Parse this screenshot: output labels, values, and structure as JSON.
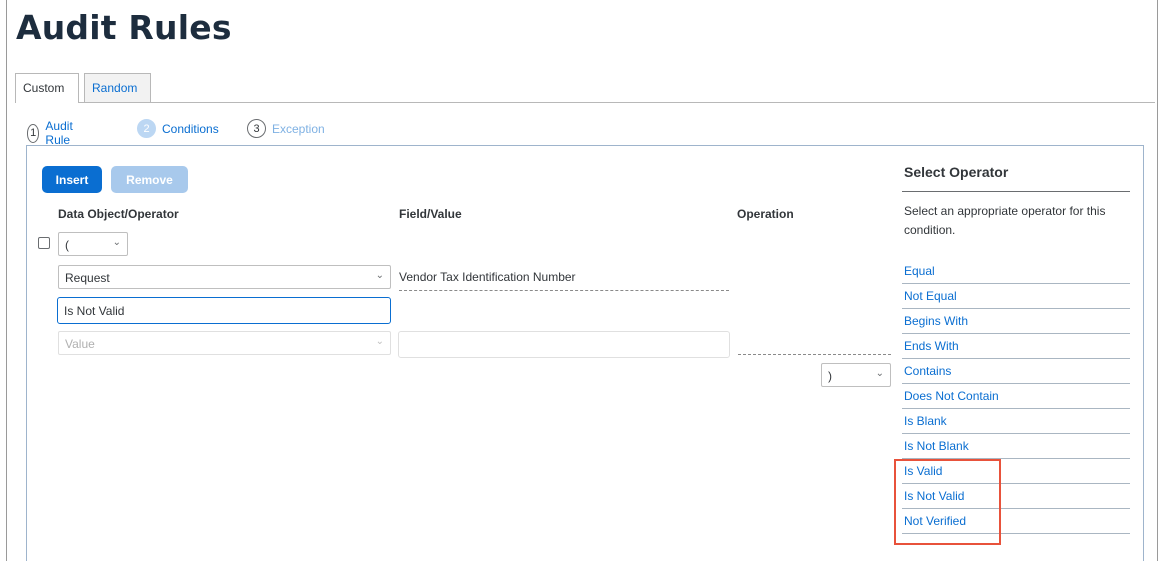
{
  "page": {
    "title": "Audit Rules"
  },
  "tabs": [
    {
      "label": "Custom",
      "active": true
    },
    {
      "label": "Random",
      "active": false
    }
  ],
  "steps": [
    {
      "num": "1",
      "label": "Audit Rule"
    },
    {
      "num": "2",
      "label": "Conditions"
    },
    {
      "num": "3",
      "label": "Exception"
    }
  ],
  "toolbar": {
    "insert_label": "Insert",
    "remove_label": "Remove"
  },
  "columns": {
    "data_object": "Data Object/Operator",
    "field_value": "Field/Value",
    "operation": "Operation"
  },
  "condition": {
    "open_paren": "(",
    "data_object": "Request",
    "field": "Vendor Tax Identification Number",
    "operator_input": "Is Not Valid",
    "value_placeholder": "Value",
    "close_paren": ")"
  },
  "side_panel": {
    "title": "Select Operator",
    "description": "Select an appropriate operator for this condition.",
    "operators": [
      "Equal",
      "Not Equal",
      "Begins With",
      "Ends With",
      "Contains",
      "Does Not Contain",
      "Is Blank",
      "Is Not Blank",
      "Is Valid",
      "Is Not Valid",
      "Not Verified"
    ]
  },
  "colors": {
    "accent": "#0a6ed1",
    "highlight": "#e8523b"
  },
  "icons": {
    "dropdown": "chevron-down-icon"
  }
}
